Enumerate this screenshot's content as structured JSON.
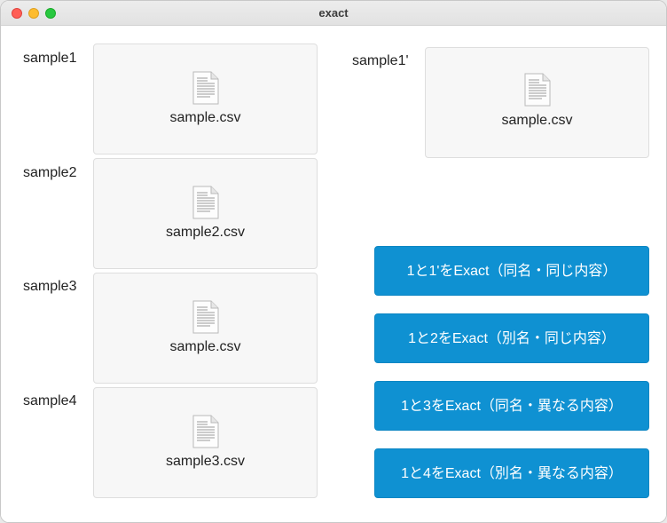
{
  "window": {
    "title": "exact"
  },
  "icons": {
    "file": "document-icon",
    "close": "close-window-icon",
    "minimize": "minimize-window-icon",
    "maximize": "maximize-window-icon"
  },
  "colors": {
    "button": "#0f91d2",
    "button_text": "#ffffff",
    "dropzone_bg": "#f7f7f7",
    "dropzone_border": "#dedede"
  },
  "samples": [
    {
      "label": "sample1",
      "file": "sample.csv"
    },
    {
      "label": "sample2",
      "file": "sample2.csv"
    },
    {
      "label": "sample3",
      "file": "sample.csv"
    },
    {
      "label": "sample4",
      "file": "sample3.csv"
    },
    {
      "label": "sample1'",
      "file": "sample.csv"
    }
  ],
  "buttons": [
    {
      "label": "1と1'をExact（同名・同じ内容）"
    },
    {
      "label": "1と2をExact（別名・同じ内容）"
    },
    {
      "label": "1と3をExact（同名・異なる内容）"
    },
    {
      "label": "1と4をExact（別名・異なる内容）"
    }
  ]
}
